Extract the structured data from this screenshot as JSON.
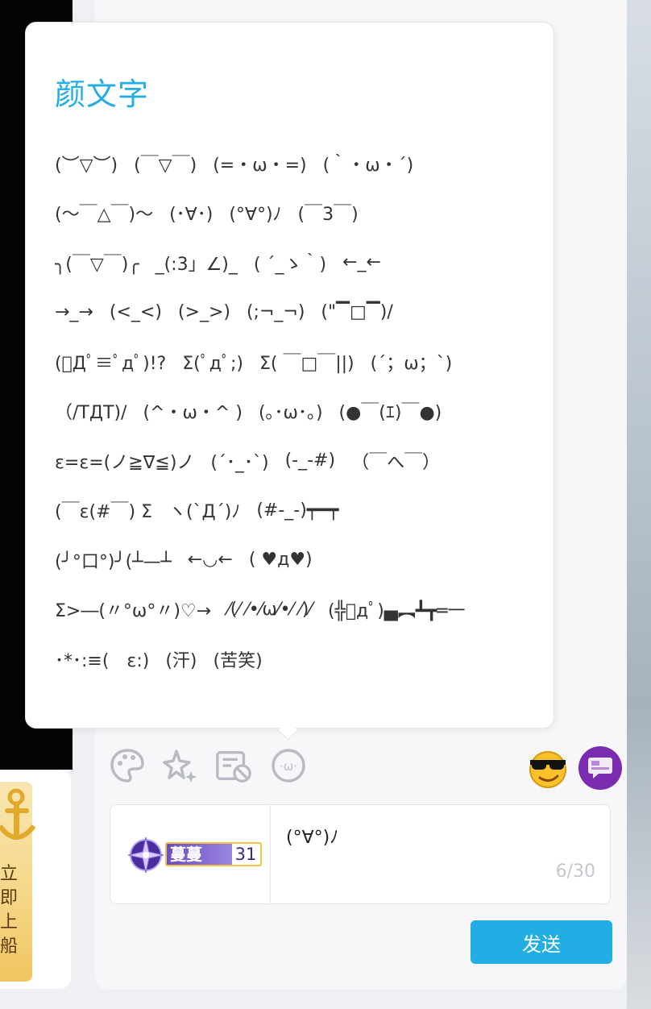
{
  "popup": {
    "title": "颜文字",
    "emoticons": [
      [
        "(︶▽︶)",
        "(￣▽￣)",
        "(=・ω・=)",
        "(｀・ω・´)"
      ],
      [
        "(〜￣△￣)〜",
        "(･∀･)",
        "(°∀°)ﾉ",
        "(￣3￣)"
      ],
      [
        "╮(￣▽￣)╭",
        "_(:3」∠)_",
        "( ´_ゝ｀)",
        "←_←"
      ],
      [
        "→_→",
        "(<_<)",
        "(>_>)",
        "(;¬_¬)",
        "(\"▔□▔)/"
      ],
      [
        "(ﾟДﾟ≡ﾟдﾟ)!?",
        "Σ(ﾟдﾟ;)",
        "Σ( ￣□￣||)",
        "(´；ω；`)"
      ],
      [
        "（/TДT)/",
        "(^・ω・^ )",
        "(｡･ω･｡)",
        "(●￣(ｴ)￣●)"
      ],
      [
        "ε=ε=(ノ≧∇≦)ノ",
        "(´･_･`)",
        "(-_-#)",
        "（￣へ￣）"
      ],
      [
        "(￣ε(#￣) Σ",
        "ヽ(`Д´)ﾉ",
        "(#-_-)┯━┯"
      ],
      [
        "(╯°口°)╯(┴—┴",
        "←◡←",
        "( ♥д♥)"
      ],
      [
        "Σ>―(〃°ω°〃)♡→",
        "⁄(⁄ ⁄•⁄ω⁄•⁄ ⁄)⁄",
        "(╬ﾟдﾟ)▄︻┻┳═一"
      ],
      [
        "･*･:≡(　ε:)",
        "(汗)",
        "(苦笑)"
      ]
    ]
  },
  "toolbar": {
    "icons": [
      "palette-icon",
      "sparkle-icon",
      "no-danmaku-icon",
      "emoticon-icon",
      "sunglasses-emoji-icon",
      "chat-bubble-icon"
    ]
  },
  "input": {
    "value": "(°∀°)ﾉ",
    "counter": "6/30"
  },
  "medal": {
    "name": "蔓蔓",
    "level": "31"
  },
  "send": {
    "label": "发送"
  },
  "promo": {
    "text": "立即上船"
  },
  "colors": {
    "accent": "#23ade5",
    "popup_title": "#23ade5",
    "medal_purple": "#6c4cc7",
    "medal_border": "#f2c53d",
    "chat_button": "#7b2bb0"
  }
}
